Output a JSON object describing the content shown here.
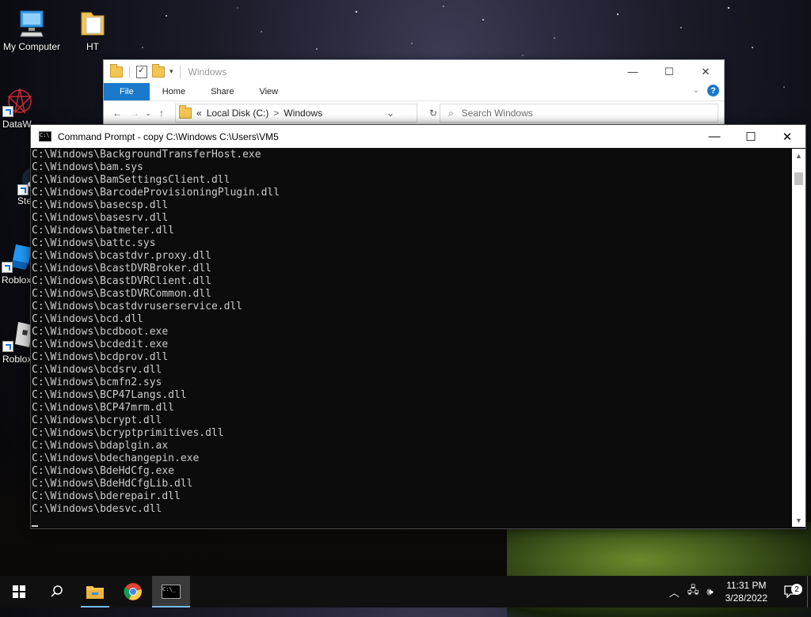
{
  "desktop": {
    "icons": [
      {
        "label": "My Computer",
        "icon": "computer-icon"
      },
      {
        "label": "HT",
        "icon": "folder-icon"
      },
      {
        "label": "DataW",
        "icon": "app-icon"
      },
      {
        "label": "Ste",
        "icon": "steam-icon"
      },
      {
        "label": "Roblox",
        "icon": "roblox-icon"
      },
      {
        "label": "Roblox",
        "icon": "roblox-studio-icon"
      }
    ]
  },
  "explorer": {
    "title": "Windows",
    "tabs": [
      "File",
      "Home",
      "Share",
      "View"
    ],
    "address": {
      "crumb_prefix": "«",
      "disk": "Local Disk (C:)",
      "separator": ">",
      "folder": "Windows"
    },
    "search_placeholder": "Search Windows",
    "help": "?"
  },
  "cmd": {
    "title": "Command Prompt - copy  C:\\Windows C:\\Users\\VM5",
    "lines": [
      "C:\\Windows\\BackgroundTransferHost.exe",
      "C:\\Windows\\bam.sys",
      "C:\\Windows\\BamSettingsClient.dll",
      "C:\\Windows\\BarcodeProvisioningPlugin.dll",
      "C:\\Windows\\basecsp.dll",
      "C:\\Windows\\basesrv.dll",
      "C:\\Windows\\batmeter.dll",
      "C:\\Windows\\battc.sys",
      "C:\\Windows\\bcastdvr.proxy.dll",
      "C:\\Windows\\BcastDVRBroker.dll",
      "C:\\Windows\\BcastDVRClient.dll",
      "C:\\Windows\\BcastDVRCommon.dll",
      "C:\\Windows\\bcastdvruserservice.dll",
      "C:\\Windows\\bcd.dll",
      "C:\\Windows\\bcdboot.exe",
      "C:\\Windows\\bcdedit.exe",
      "C:\\Windows\\bcdprov.dll",
      "C:\\Windows\\bcdsrv.dll",
      "C:\\Windows\\bcmfn2.sys",
      "C:\\Windows\\BCP47Langs.dll",
      "C:\\Windows\\BCP47mrm.dll",
      "C:\\Windows\\bcrypt.dll",
      "C:\\Windows\\bcryptprimitives.dll",
      "C:\\Windows\\bdaplgin.ax",
      "C:\\Windows\\bdechangepin.exe",
      "C:\\Windows\\BdeHdCfg.exe",
      "C:\\Windows\\BdeHdCfgLib.dll",
      "C:\\Windows\\bderepair.dll",
      "C:\\Windows\\bdesvc.dll"
    ]
  },
  "taskbar": {
    "time": "11:31 PM",
    "date": "3/28/2022",
    "notification_count": "2"
  }
}
